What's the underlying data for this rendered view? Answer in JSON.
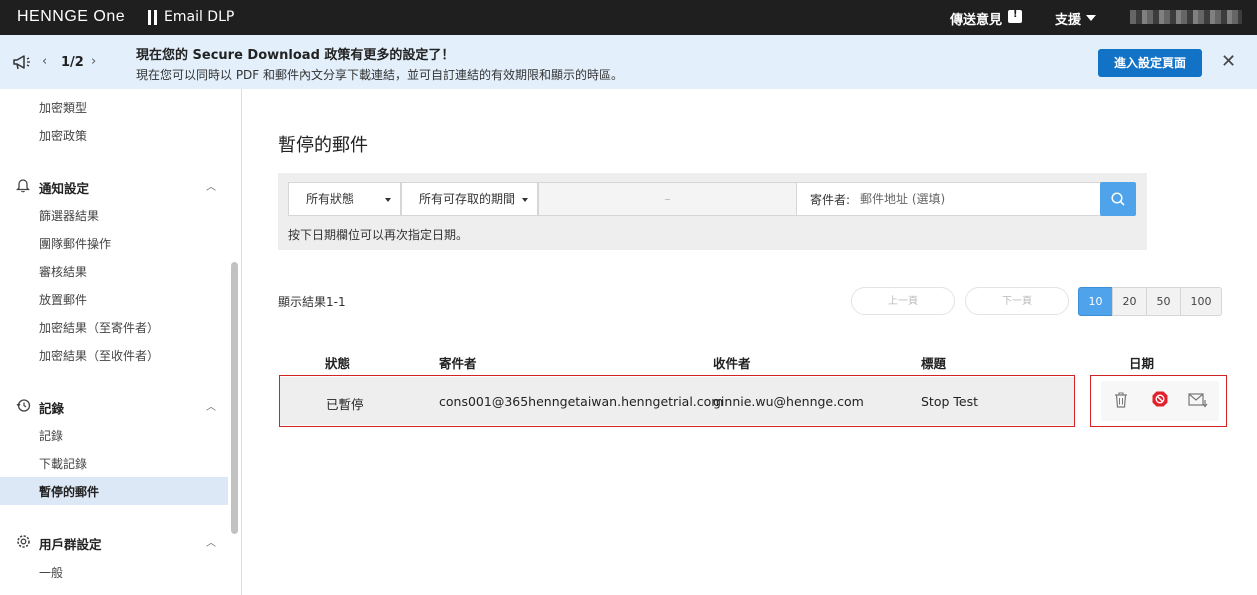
{
  "topbar": {
    "brand": "HENNGE One",
    "app": "Email DLP",
    "feedback": "傳送意見",
    "support": "支援"
  },
  "banner": {
    "pager": "1/2",
    "title": "現在您的 Secure Download 政策有更多的設定了！",
    "text": "現在您可以同時以 PDF 和郵件內文分享下載連結，並可自訂連結的有效期限和顯示的時區。",
    "button": "進入設定頁面"
  },
  "sidebar": {
    "top_items": [
      "加密類型",
      "加密政策"
    ],
    "sections": [
      {
        "title": "通知設定",
        "items": [
          "篩選器結果",
          "團隊郵件操作",
          "審核結果",
          "放置郵件",
          "加密結果（至寄件者）",
          "加密結果（至收件者）"
        ]
      },
      {
        "title": "記錄",
        "items": [
          "記錄",
          "下載記錄",
          "暫停的郵件"
        ]
      },
      {
        "title": "用戶群設定",
        "items": [
          "一般"
        ]
      }
    ],
    "active_item": "暫停的郵件"
  },
  "main": {
    "title": "暫停的郵件",
    "filters": {
      "status": "所有狀態",
      "period": "所有可存取的期間",
      "date_separator": "–",
      "sender_label": "寄件者:",
      "sender_placeholder": "郵件地址 (選填)",
      "hint": "按下日期欄位可以再次指定日期。"
    },
    "results": {
      "label": "顯示結果1-1",
      "prev": "上一頁",
      "next": "下一頁",
      "sizes": [
        "10",
        "20",
        "50",
        "100"
      ],
      "active_size": "10"
    },
    "table": {
      "columns": [
        "狀態",
        "寄件者",
        "收件者",
        "標題",
        "日期"
      ],
      "rows": [
        {
          "status": "已暫停",
          "sender": "cons001@365henngetaiwan.hennge trial.com",
          "recipient": "ginnie.wu@hennge.com",
          "subject": "Stop Test"
        }
      ]
    }
  },
  "colors": {
    "accent": "#1172c6",
    "highlight_border": "#d12323",
    "active_nav": "#dce8f5"
  }
}
